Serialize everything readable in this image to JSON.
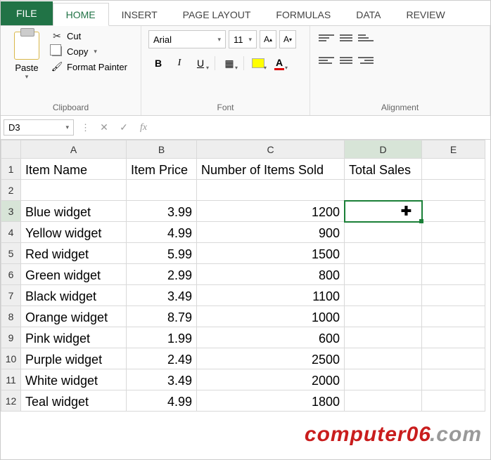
{
  "tabs": {
    "file": "FILE",
    "home": "HOME",
    "insert": "INSERT",
    "page_layout": "PAGE LAYOUT",
    "formulas": "FORMULAS",
    "data": "DATA",
    "review": "REVIEW"
  },
  "ribbon": {
    "clipboard": {
      "paste": "Paste",
      "cut": "Cut",
      "copy": "Copy",
      "format_painter": "Format Painter",
      "group_label": "Clipboard"
    },
    "font": {
      "name": "Arial",
      "size": "11",
      "increase": "A˄",
      "decrease": "A˅",
      "bold": "B",
      "italic": "I",
      "underline": "U",
      "font_color_letter": "A",
      "group_label": "Font"
    },
    "alignment": {
      "group_label": "Alignment"
    }
  },
  "formula_bar": {
    "name_box": "D3",
    "fx_label": "fx",
    "value": ""
  },
  "columns": [
    "A",
    "B",
    "C",
    "D",
    "E"
  ],
  "active_cell": "D3",
  "headers": {
    "A": "Item Name",
    "B": "Item Price",
    "C": "Number of Items Sold",
    "D": "Total Sales"
  },
  "rows": [
    {
      "n": "1",
      "A": "Item Name",
      "B": "Item Price",
      "C": "Number of Items Sold",
      "D": "Total Sales"
    },
    {
      "n": "2",
      "A": "",
      "B": "",
      "C": "",
      "D": ""
    },
    {
      "n": "3",
      "A": "Blue widget",
      "B": "3.99",
      "C": "1200",
      "D": ""
    },
    {
      "n": "4",
      "A": "Yellow widget",
      "B": "4.99",
      "C": "900",
      "D": ""
    },
    {
      "n": "5",
      "A": "Red widget",
      "B": "5.99",
      "C": "1500",
      "D": ""
    },
    {
      "n": "6",
      "A": "Green widget",
      "B": "2.99",
      "C": "800",
      "D": ""
    },
    {
      "n": "7",
      "A": "Black widget",
      "B": "3.49",
      "C": "1100",
      "D": ""
    },
    {
      "n": "8",
      "A": "Orange widget",
      "B": "8.79",
      "C": "1000",
      "D": ""
    },
    {
      "n": "9",
      "A": "Pink widget",
      "B": "1.99",
      "C": "600",
      "D": ""
    },
    {
      "n": "10",
      "A": "Purple widget",
      "B": "2.49",
      "C": "2500",
      "D": ""
    },
    {
      "n": "11",
      "A": "White widget",
      "B": "3.49",
      "C": "2000",
      "D": ""
    },
    {
      "n": "12",
      "A": "Teal widget",
      "B": "4.99",
      "C": "1800",
      "D": ""
    }
  ],
  "watermark": {
    "a": "computer06",
    "b": ".com"
  }
}
